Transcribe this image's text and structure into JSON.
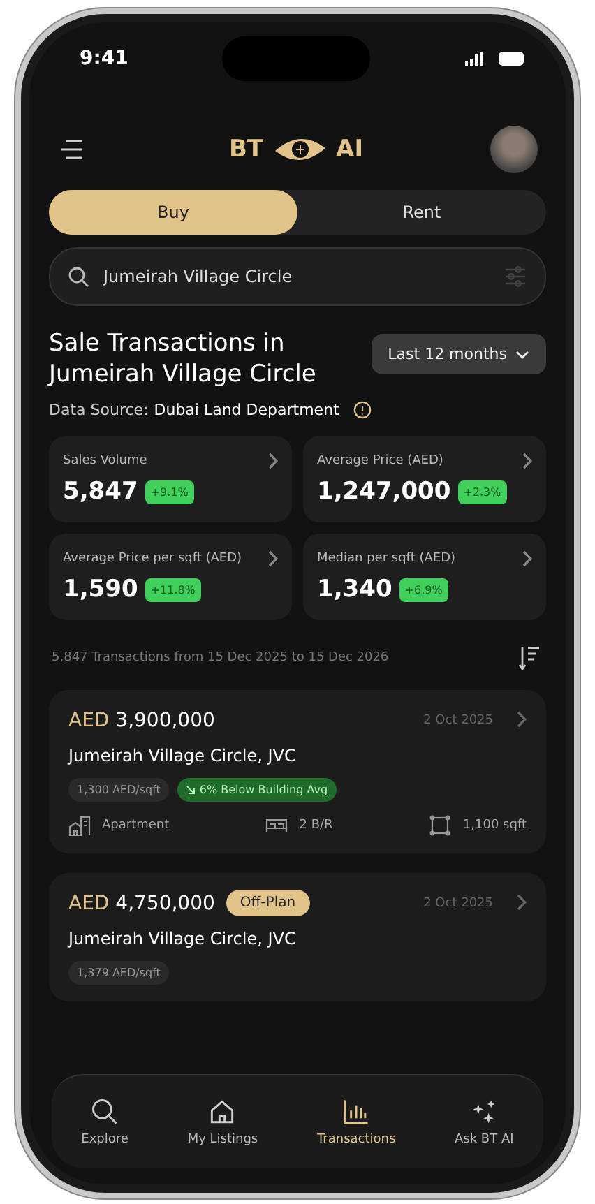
{
  "status_bar": {
    "time": "9:41"
  },
  "header": {
    "logo_left": "BT",
    "logo_right": "AI"
  },
  "tabs": [
    {
      "label": "Buy",
      "selected": true
    },
    {
      "label": "Rent",
      "selected": false
    }
  ],
  "search": {
    "value": "Jumeirah Village Circle"
  },
  "title": "Sale Transactions in Jumeirah Village Circle",
  "period": "Last 12 months",
  "source": {
    "label": "Data Source:",
    "value": "Dubai Land Department"
  },
  "stats": [
    {
      "label": "Sales Volume",
      "value": "5,847",
      "change": "+9.1%"
    },
    {
      "label": "Average Price (AED)",
      "value": "1,247,000",
      "change": "+2.3%"
    },
    {
      "label": "Average Price per sqft (AED)",
      "value": "1,590",
      "change": "+11.8%"
    },
    {
      "label": "Median per sqft (AED)",
      "value": "1,340",
      "change": "+6.9%"
    }
  ],
  "summary": "5,847 Transactions from 15 Dec 2025 to 15 Dec 2026",
  "transactions": [
    {
      "currency": "AED",
      "price": "3,900,000",
      "date": "2 Oct 2025",
      "location": "Jumeirah Village Circle, JVC",
      "chips": [
        {
          "kind": "plain",
          "text": "1,300 AED/sqft"
        },
        {
          "kind": "below",
          "text": "6% Below Building Avg"
        }
      ],
      "details": [
        {
          "kind": "type",
          "text": "Apartment"
        },
        {
          "kind": "beds",
          "text": "2 B/R"
        },
        {
          "kind": "area",
          "text": "1,100 sqft"
        }
      ]
    },
    {
      "currency": "AED",
      "price": "4,750,000",
      "tag": "Off-Plan",
      "date": "2 Oct 2025",
      "location": "Jumeirah Village Circle, JVC",
      "chips": [
        {
          "kind": "plain",
          "text": "1,379 AED/sqft"
        }
      ]
    }
  ],
  "nav": [
    {
      "label": "Explore",
      "selected": false
    },
    {
      "label": "My Listings",
      "selected": false
    },
    {
      "label": "Transactions",
      "selected": true
    },
    {
      "label": "Ask BT AI",
      "selected": false
    }
  ]
}
